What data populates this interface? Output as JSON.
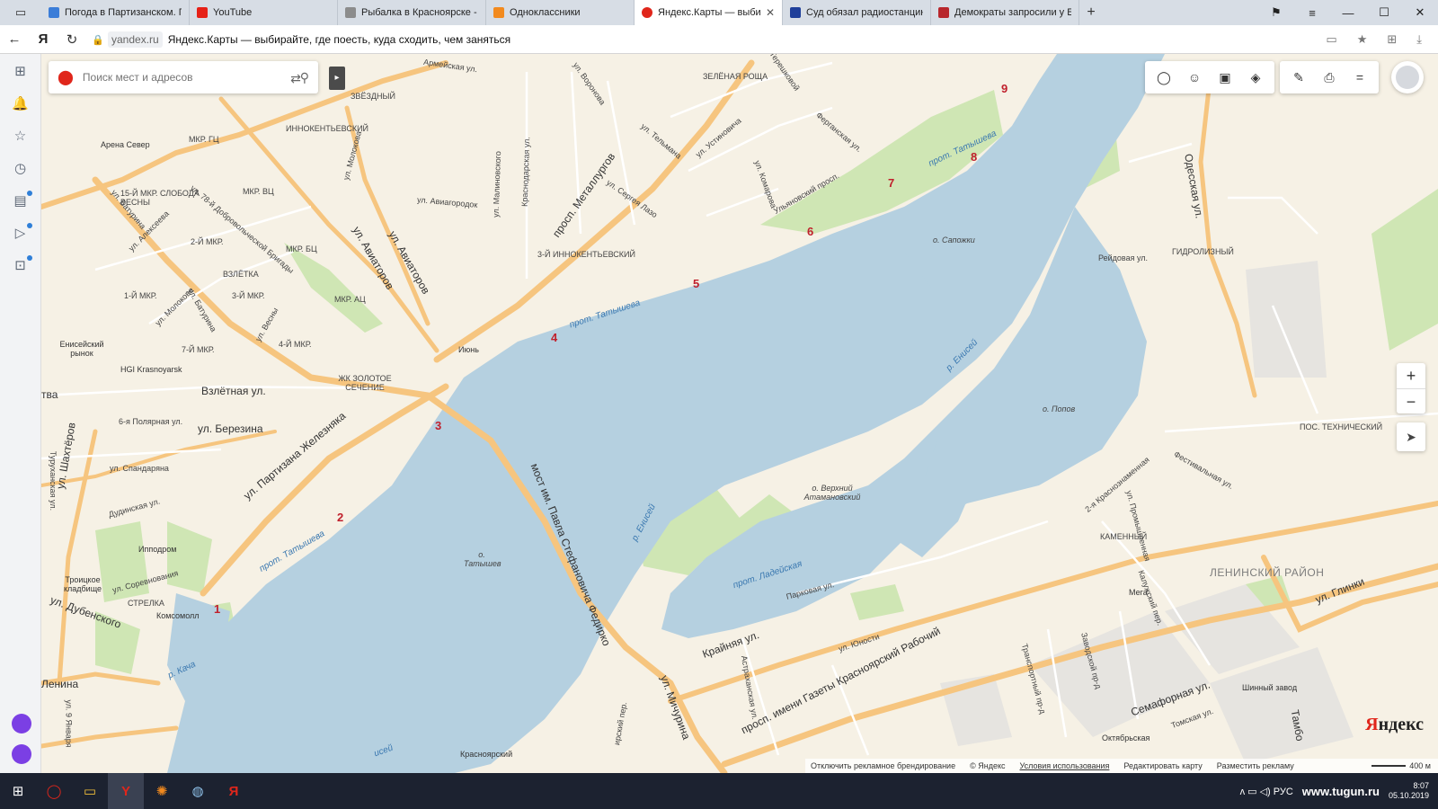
{
  "browser": {
    "tabs": [
      {
        "title": "Погода в Партизанском. П",
        "color": "#3b7dd8",
        "active": false
      },
      {
        "title": "YouTube",
        "color": "#e62117",
        "active": false
      },
      {
        "title": "Рыбалка в Красноярске - З",
        "color": "#8c8c8c",
        "active": false
      },
      {
        "title": "Одноклассники",
        "color": "#f28a1e",
        "active": false
      },
      {
        "title": "Яндекс.Карты — выбир",
        "color": "#e0261b",
        "active": true
      },
      {
        "title": "Суд обязал радиостанцию",
        "color": "#1f3f9a",
        "active": false
      },
      {
        "title": "Демократы запросили у Б",
        "color": "#b8272c",
        "active": false
      }
    ],
    "tab_close": "✕",
    "new_tab": "+",
    "window_controls": {
      "bookmarks": "⚑",
      "menu": "≡",
      "minimize": "—",
      "maximize": "☐",
      "close": "✕"
    },
    "nav": {
      "back": "←",
      "yandex": "Я",
      "reload": "↻"
    },
    "address": {
      "domain": "yandex.ru",
      "title": "Яндекс.Карты — выбирайте, где поесть, куда сходить, чем заняться"
    },
    "addr_icons": {
      "reader": "▭",
      "bookmark": "★",
      "extensions": "⊞",
      "download": "⤓"
    }
  },
  "sidebar": {
    "icons": [
      "grid-icon",
      "bell-icon",
      "star-icon",
      "clock-icon",
      "collections-icon",
      "play-icon",
      "lens-icon"
    ],
    "glyphs": [
      "⊞",
      "🔔",
      "☆",
      "◷",
      "▤",
      "▷",
      "⊡"
    ]
  },
  "map": {
    "search": {
      "placeholder": "Поиск мест и адресов",
      "pin": "⬤",
      "search_icon": "⚲",
      "route_icon": "⇄",
      "collapse": "▸"
    },
    "tools_group1": [
      "◯",
      "☺",
      "▣",
      "◈"
    ],
    "tools_group2": [
      "✎",
      "⎙",
      "="
    ],
    "zoom": {
      "in": "+",
      "out": "−"
    },
    "locate": "➤",
    "logo": {
      "first": "Я",
      "rest": "ндекс"
    },
    "copyright": {
      "disable_ads": "Отключить рекламное брендирование",
      "copy": "© Яндекс",
      "terms": "Условия использования",
      "edit": "Редактировать карту",
      "advertise": "Разместить рекламу",
      "scale": "400 м"
    },
    "markers": [
      "1",
      "2",
      "3",
      "4",
      "5",
      "6",
      "7",
      "8",
      "9"
    ],
    "streets": {
      "armeyskaya": "Армейская ул.",
      "voronova": "ул. Воронова",
      "zelenaya_roshcha": "ЗЕЛЁНАЯ РОЩА",
      "tereshkovoy": "ул. Терешковой",
      "zvezdny": "ЗВЁЗДНЫЙ",
      "innokent1": "ИННОКЕНТЬЕВСКИЙ",
      "molokova": "ул. Молокова",
      "mkr_gc": "МКР. ГЦ",
      "arena": "Арена Север",
      "mkr_vc": "МКР. ВЦ",
      "sloboda": "15-Й МКР. СЛОБОДА ВЕСНЫ",
      "dobrovol": "ул. 78-й Добровольческой Бригады",
      "aviatorov1": "ул. Авиаторов",
      "aviatorov2": "ул. Авиаторов",
      "alekseeva": "ул. Алексеева",
      "baturina1": "ул. Батурина",
      "mkr2": "2-Й МКР.",
      "mkr_bc": "МКР. БЦ",
      "vzletka": "ВЗЛЁТКА",
      "mkr1": "1-Й МКР.",
      "mkr3": "3-Й МКР.",
      "mkr_ac": "МКР. АЦ",
      "molokova2": "ул. Молокова",
      "baturina2": "ул. Батурина",
      "vesny": "ул. Весны",
      "mkr4": "4-Й МКР.",
      "mkr7": "7-Й МКР.",
      "eniseysky": "Енисейский рынок",
      "hgi": "HGI Krasnoyarsk",
      "zolotoe": "ЖК ЗОЛОТОЕ СЕЧЕНИЕ",
      "iyun": "Июнь",
      "vzletnaya": "Взлётная ул.",
      "tva": "тва",
      "poyarnaya": "6-я Полярная ул.",
      "berezina": "ул. Березина",
      "shahterov": "ул. Шахтёров",
      "spandaryana": "ул. Спандаряна",
      "turuhanskaya": "Туруханская ул.",
      "zheleznyaka": "ул. Партизана Железняка",
      "dudinskaya": "Дудинская ул.",
      "ippodrom": "Ипподром",
      "troitskoe": "Троицкое кладбище",
      "sorevnovaniya": "ул. Соревнования",
      "strelka": "СТРЕЛКА",
      "komsomoll": "Комсомолл",
      "dubenskogo": "ул. Дубенского",
      "lenina": "Ленина",
      "yanvarya": "ул. 9 Января",
      "metallurgov": "просп. Металлургов",
      "tatysheva_top": "ул. Сергея Лазо",
      "tel_mana": "ул. Тельмана",
      "ustinovicha": "ул. Устиновича",
      "komarova": "ул. Комарова",
      "ulyanovsky": "Ульяновский просп.",
      "ferganskaya": "Ферганская ул.",
      "aviagorodok": "ул. Авиагородок",
      "malinovskogo": "ул. Малиновского",
      "krasnodarskaya": "Краснодарская ул.",
      "innokent3": "3-Й ИННОКЕНТЬЕВСКИЙ",
      "most": "мост им. Павла Стефановича Федирко",
      "tatyshev_isl": "о. Татышев",
      "kraynyaya": "Крайняя ул.",
      "michurina": "ул. Мичурина",
      "irsky": "ирский пер.",
      "astrakhanskaya": "Астраханская ул.",
      "parkovaya": "Парковая ул.",
      "yunosti": "ул. Юности",
      "gazety": "просп. имени Газеты Красноярский Рабочий",
      "transportny": "Транспортный пр-д",
      "zavodskoy": "Заводской пр-д",
      "semafornaya": "Семафорная ул.",
      "tomskaya": "Томская ул.",
      "shinny": "Шинный завод",
      "oktyabrskaya": "Октябрьская",
      "tambovskaya": "Тамбо",
      "krasnoyarsky": "Красноярский",
      "mega": "Мега",
      "kamenny": "КАМЕННЫЙ",
      "kaluzhskaya": "Калужский пер.",
      "promyshlennaya": "ул. Промышленная",
      "krasnaya2": "2-я Краснознаменная",
      "festivalnaya": "Фестивальная ул.",
      "leninsky": "ЛЕНИНСКИЙ РАЙОН",
      "glinki": "ул. Глинки",
      "tehnichesky": "ПОС. ТЕХНИЧЕСКИЙ",
      "odesskaya": "Одесская ул.",
      "reydovaya": "Рейдовая ул.",
      "gidrolizny": "ГИДРОЛИЗНЫЙ",
      "sapozhki": "о. Сапожки",
      "popov": "о. Попов",
      "atamanovsky": "о. Верхний Атамановский"
    },
    "water": {
      "tatysheva1": "прот. Татышева",
      "tatysheva2": "прот. Татышева",
      "tatysheva3": "прот. Татышева",
      "enisey1": "р. Енисей",
      "enisey2": "р. Енисей",
      "ladeyskaya": "прот. Ладейская",
      "kacha": "р. Кача",
      "enisey_bottom": "исей"
    }
  },
  "taskbar": {
    "start": "⊞",
    "apps": [
      "◯",
      "▭",
      "Y",
      "✺",
      "◍",
      "Я"
    ],
    "tray": "ʌ  ▭  ◁)  РУС",
    "watermark": "www.tugun.ru",
    "time": "8:07",
    "date": "05.10.2019"
  },
  "colors": {
    "water": "#b5d0e0",
    "land": "#f6f1e5",
    "green": "#cfe6b4",
    "road_major": "#f6c57f",
    "road_minor": "#ffffff",
    "marker": "#c0202c"
  }
}
